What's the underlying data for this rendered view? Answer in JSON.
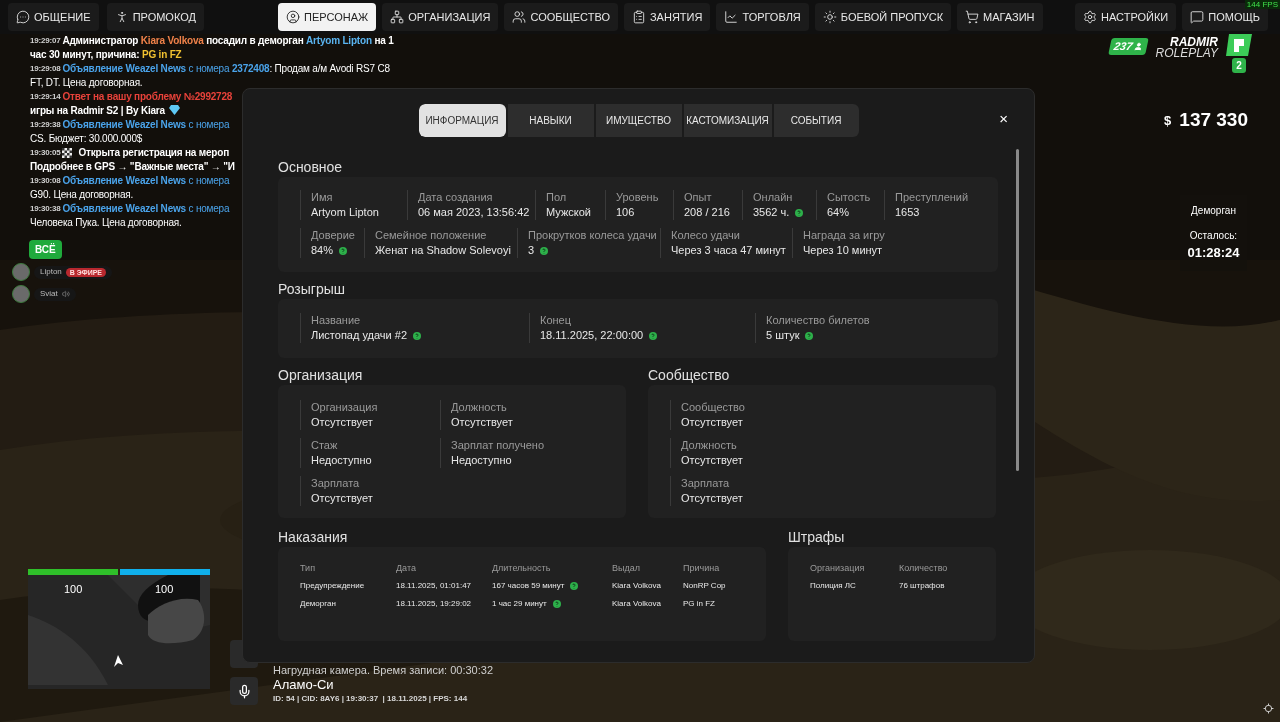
{
  "topbar": {
    "left": [
      {
        "label": "ОБЩЕНИЕ",
        "selected": false
      },
      {
        "label": "ПРОМОКОД",
        "selected": false
      }
    ],
    "center": [
      {
        "label": "ПЕРСОНАЖ",
        "selected": true
      },
      {
        "label": "ОРГАНИЗАЦИЯ",
        "selected": false
      },
      {
        "label": "СООБЩЕСТВО",
        "selected": false
      },
      {
        "label": "ЗАНЯТИЯ",
        "selected": false
      },
      {
        "label": "ТОРГОВЛЯ",
        "selected": false
      },
      {
        "label": "БОЕВОЙ ПРОПУСК",
        "selected": false
      },
      {
        "label": "МАГАЗИН",
        "selected": false
      }
    ],
    "right": [
      {
        "label": "НАСТРОЙКИ",
        "selected": false
      },
      {
        "label": "ПОМОЩЬ",
        "selected": false
      }
    ],
    "fps": "144 FPS"
  },
  "chat": [
    {
      "lines": [
        [
          {
            "kind": "time",
            "text": "19:29:07"
          },
          {
            "kind": "text",
            "text": "Администратор "
          },
          {
            "kind": "player",
            "text": "Kiara Volkova"
          },
          {
            "kind": "text",
            "text": " посадил в деморган "
          },
          {
            "kind": "target",
            "text": "Artyom Lipton"
          },
          {
            "kind": "text",
            "text": " на 1"
          }
        ],
        [
          {
            "kind": "text",
            "text": "час 30 минут, причина: "
          },
          {
            "kind": "highlight",
            "text": "PG in FZ"
          }
        ]
      ]
    },
    {
      "lines": [
        [
          {
            "kind": "time",
            "text": "19:29:08"
          },
          {
            "kind": "news",
            "text": "Объявление Weazel News"
          },
          {
            "kind": "news-plain",
            "text": " с номера "
          },
          {
            "kind": "news",
            "text": "2372408"
          },
          {
            "kind": "plain",
            "text": ": Продам а/м Avodi RS7 C8"
          }
        ],
        [
          {
            "kind": "plain",
            "text": "FT, DT. Цена договорная."
          }
        ]
      ]
    },
    {
      "lines": [
        [
          {
            "kind": "time",
            "text": "19:29:14"
          },
          {
            "kind": "alert",
            "text": "Ответ на вашу проблему №2992728"
          }
        ],
        [
          {
            "kind": "text",
            "text": "игры на Radmir S2 | By Kiara"
          },
          {
            "kind": "gem"
          }
        ]
      ]
    },
    {
      "lines": [
        [
          {
            "kind": "time",
            "text": "19:29:38"
          },
          {
            "kind": "news",
            "text": "Объявление Weazel News"
          },
          {
            "kind": "news-plain",
            "text": " с номера"
          }
        ],
        [
          {
            "kind": "plain",
            "text": "CS. Бюджет: 30.000.000$"
          }
        ]
      ]
    },
    {
      "lines": [
        [
          {
            "kind": "time",
            "text": "19:30:05"
          },
          {
            "kind": "flag"
          },
          {
            "kind": "text",
            "text": "Открыта регистрация на мероп"
          }
        ],
        [
          {
            "kind": "text",
            "text": "Подробнее в GPS → \"Важные места\" → \"И"
          }
        ]
      ]
    },
    {
      "lines": [
        [
          {
            "kind": "time",
            "text": "19:30:08"
          },
          {
            "kind": "news",
            "text": "Объявление Weazel News"
          },
          {
            "kind": "news-plain",
            "text": " с номера"
          }
        ],
        [
          {
            "kind": "plain",
            "text": "G90. Цена договорная."
          }
        ]
      ]
    },
    {
      "lines": [
        [
          {
            "kind": "time",
            "text": "19:30:38"
          },
          {
            "kind": "news",
            "text": "Объявление Weazel News"
          },
          {
            "kind": "news-plain",
            "text": " с номера"
          }
        ],
        [
          {
            "kind": "plain",
            "text": "Человека Пука. Цена договорная."
          }
        ]
      ]
    }
  ],
  "voice": {
    "filter": "ВСЁ",
    "members": [
      {
        "name": "Lipton",
        "live": true,
        "badge": "В ЭФИРЕ"
      },
      {
        "name": "Sviat",
        "live": false
      }
    ]
  },
  "hud": {
    "online": "237",
    "logo_line1": "RADMIR",
    "logo_line2": "ROLEPLAY",
    "server": "2",
    "money_symbol": "$",
    "money": "137 330",
    "jail_title": "Деморган",
    "jail_label": "Осталось:",
    "jail_timer": "01:28:24"
  },
  "minimap": {
    "health": {
      "level": 1,
      "reading": "100"
    },
    "armor": {
      "level": 1,
      "reading": "100"
    }
  },
  "status": {
    "camera": "Нагрудная камера. Время записи: 00:30:32",
    "location": "Аламо-Си",
    "info": "ID: 54 | CID: 8AY6 | 19:30:37  | 18.11.2025 | FPS: 144"
  },
  "profile": {
    "tabs": [
      {
        "label": "ИНФОРМАЦИЯ",
        "selected": true
      },
      {
        "label": "НАВЫКИ",
        "selected": false
      },
      {
        "label": "ИМУЩЕСТВО",
        "selected": false
      },
      {
        "label": "КАСТОМИЗАЦИЯ",
        "selected": false
      },
      {
        "label": "СОБЫТИЯ",
        "selected": false
      }
    ],
    "close": "×",
    "basic": {
      "title": "Основное",
      "rows": [
        {
          "fields": [
            {
              "label": "Имя",
              "value": "Artyom Lipton",
              "info": false
            },
            {
              "label": "Дата создания",
              "value": "06 мая 2023, 13:56:42",
              "info": false
            },
            {
              "label": "Пол",
              "value": "Мужской",
              "info": false
            },
            {
              "label": "Уровень",
              "value": "106",
              "info": false
            },
            {
              "label": "Опыт",
              "value": "208 / 216",
              "info": false
            },
            {
              "label": "Онлайн",
              "value": "3562 ч.",
              "info": true
            },
            {
              "label": "Сытость",
              "value": "64%",
              "info": false
            },
            {
              "label": "Преступлений",
              "value": "1653",
              "info": false
            }
          ]
        },
        {
          "fields": [
            {
              "label": "Доверие",
              "value": "84%",
              "info": true
            },
            {
              "label": "Семейное положение",
              "value": "Женат на Shadow Solevoyi",
              "info": false
            },
            {
              "label": "Прокрутков колеса удачи",
              "value": "3",
              "info": true
            },
            {
              "label": "Колесо удачи",
              "value": "Через 3 часа 47 минут",
              "info": false
            },
            {
              "label": "Награда за игру",
              "value": "Через 10 минут",
              "info": false
            }
          ]
        }
      ]
    },
    "raffle": {
      "title": "Розыгрыш",
      "fields": [
        {
          "label": "Название",
          "value": "Листопад удачи #2",
          "info": true
        },
        {
          "label": "Конец",
          "value": "18.11.2025, 22:00:00",
          "info": true
        },
        {
          "label": "Количество билетов",
          "value": "5 штук",
          "info": true
        }
      ]
    },
    "organization": {
      "title": "Организация",
      "fields": [
        {
          "label": "Организация",
          "value": "Отсутствует",
          "info": false
        },
        {
          "label": "Должность",
          "value": "Отсутствует",
          "info": false
        },
        {
          "label": "Стаж",
          "value": "Недоступно",
          "info": false
        },
        {
          "label": "Зарплат получено",
          "value": "Недоступно",
          "info": false
        },
        {
          "label": "Зарплата",
          "value": "Отсутствует",
          "info": false
        }
      ]
    },
    "community": {
      "title": "Сообщество",
      "fields": [
        {
          "label": "Сообщество",
          "value": "Отсутствует",
          "info": false
        },
        {
          "label": "Должность",
          "value": "Отсутствует",
          "info": false
        },
        {
          "label": "Зарплата",
          "value": "Отсутствует",
          "info": false
        }
      ]
    },
    "punishments": {
      "title": "Наказания",
      "columns": [
        "Тип",
        "Дата",
        "Длительность",
        "Выдал",
        "Причина"
      ],
      "rows": [
        {
          "cells": [
            "Предупреждение",
            "18.11.2025, 01:01:47",
            "167 часов 59 минут",
            "Kiara Volkova",
            "NonRP Cop"
          ],
          "info": true
        },
        {
          "cells": [
            "Деморган",
            "18.11.2025, 19:29:02",
            "1 час 29 минут",
            "Kiara Volkova",
            "PG in FZ"
          ],
          "info": true
        }
      ]
    },
    "fines": {
      "title": "Штрафы",
      "columns": [
        "Организация",
        "Количество"
      ],
      "rows": [
        {
          "cells": [
            "Полиция ЛС",
            "76 штрафов"
          ]
        }
      ]
    }
  }
}
